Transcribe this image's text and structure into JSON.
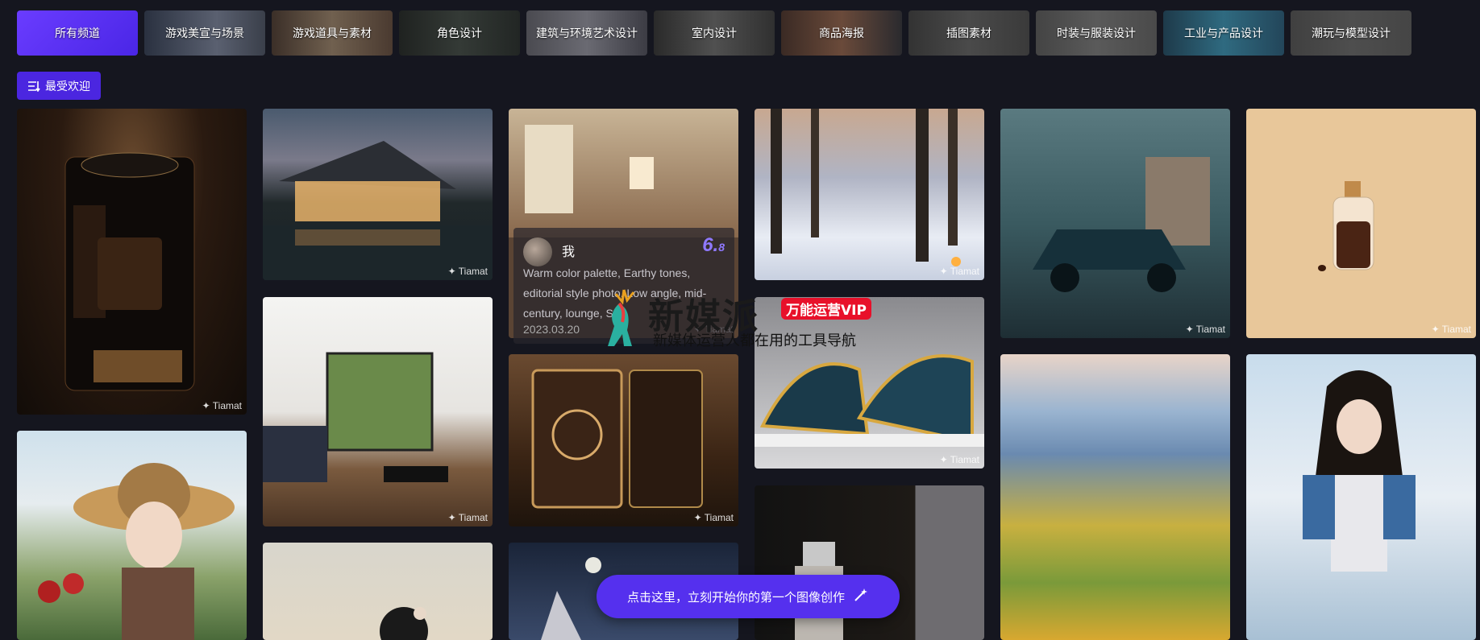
{
  "tabs": [
    {
      "label": "所有频道",
      "active": true
    },
    {
      "label": "游戏美宣与场景"
    },
    {
      "label": "游戏道具与素材"
    },
    {
      "label": "角色设计"
    },
    {
      "label": "建筑与环境艺术设计"
    },
    {
      "label": "室内设计"
    },
    {
      "label": "商品海报"
    },
    {
      "label": "插图素材"
    },
    {
      "label": "时装与服装设计"
    },
    {
      "label": "工业与产品设计"
    },
    {
      "label": "潮玩与模型设计"
    }
  ],
  "sort": {
    "label": "最受欢迎",
    "icon": "sort-icon"
  },
  "watermark_text": "✦ Tiamat",
  "hover_card": {
    "user": "我",
    "score_main": "6.",
    "score_decimal": "8",
    "prompt": "Warm color palette, Earthy tones, editorial style photo, Low angle, mid-century, lounge, Su",
    "date": "2023.03.20"
  },
  "overlay_logo": {
    "title": "新媒派",
    "badge": "万能运营VIP",
    "subtitle": "新媒体运营人都在用的工具导航"
  },
  "cta": {
    "label": "点击这里，立刻开始你的第一个图像创作",
    "icon": "magic-wand-icon"
  },
  "colors": {
    "accent": "#5530ee",
    "background": "#15161f",
    "score": "#8f79ff",
    "badge": "#e8102a"
  }
}
